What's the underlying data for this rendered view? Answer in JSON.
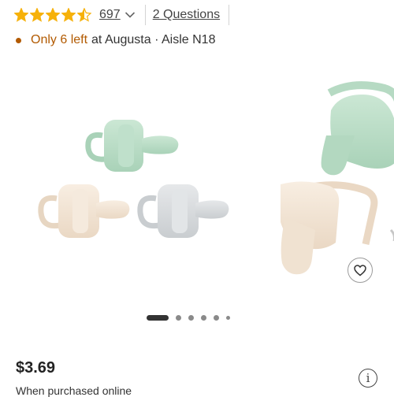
{
  "rating": {
    "stars_value": 4.5,
    "stars_max": 5,
    "count": "697",
    "questions_label": "2 Questions",
    "star_color": "#F6B10A"
  },
  "stock": {
    "warning": "Only 6 left",
    "location": "at Augusta · Aisle N18",
    "warning_color": "#B25A00",
    "dot_color": "#B25A00"
  },
  "gallery": {
    "slide_count": 6,
    "active_slide": 1,
    "colors": {
      "mint": "#B9DCC6",
      "cream": "#F2E4D3",
      "gray": "#D9DCDE"
    }
  },
  "product": {
    "price": "$3.69",
    "price_note": "When purchased online"
  },
  "icons": {
    "favorite": "heart-icon",
    "info": "info-icon",
    "expand": "chevron-down-icon"
  }
}
